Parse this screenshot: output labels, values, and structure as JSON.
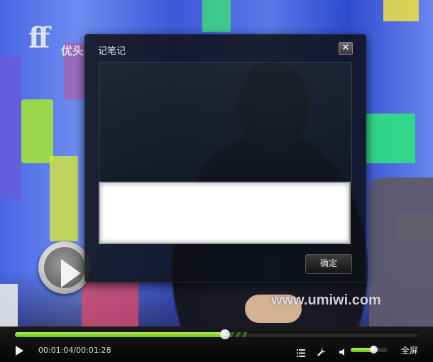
{
  "video": {
    "logo_mark": "ff",
    "logo_text": "优头",
    "watermark": "www.umiwi.com"
  },
  "dialog": {
    "title": "记笔记",
    "close_glyph": "✕",
    "note_value": "",
    "confirm_label": "确定"
  },
  "controls": {
    "current_time": "00:01:04",
    "separator": "/",
    "total_time": "00:01:28",
    "progress_fraction": 0.5218,
    "buffered_fraction": 0.58,
    "volume_fraction": 0.62,
    "fullscreen_label": "全屏",
    "icons": [
      "play-icon",
      "playlist-icon",
      "wrench-icon",
      "volume-icon"
    ]
  },
  "colors": {
    "progress_accent": "#8fdc2e",
    "dialog_bg": "#0e1016",
    "control_bar_bg": "#0a0a0a"
  }
}
